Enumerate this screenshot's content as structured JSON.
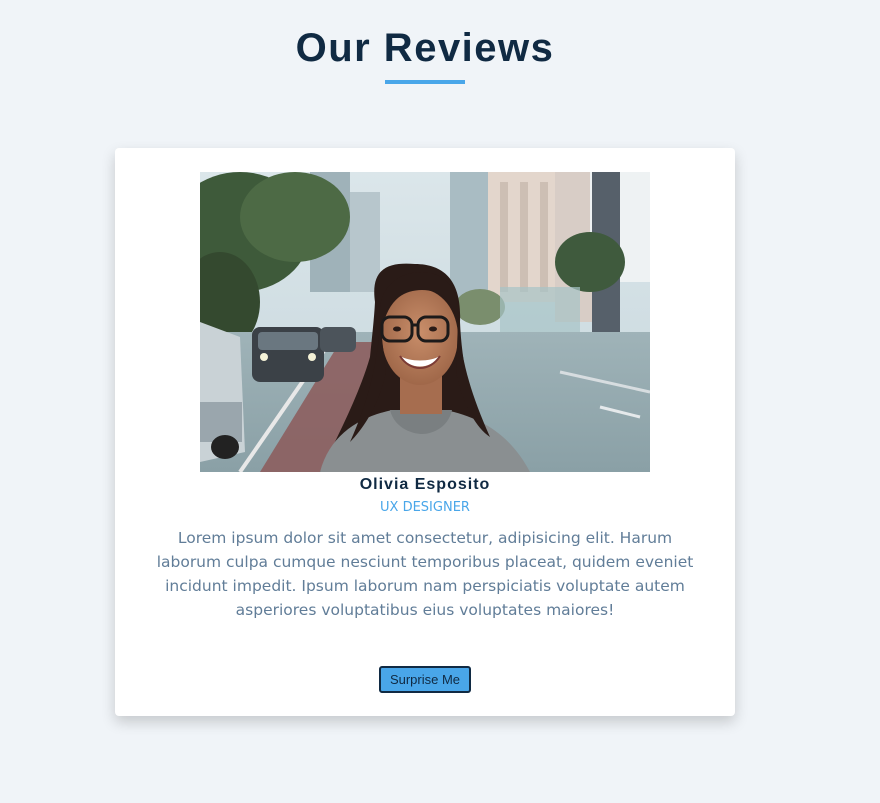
{
  "header": {
    "title": "Our Reviews"
  },
  "review": {
    "photo_alt": "Olivia Esposito",
    "author": "Olivia Esposito",
    "job": "UX DESIGNER",
    "info": "Lorem ipsum dolor sit amet consectetur, adipisicing elit. Harum laborum culpa cumque nesciunt temporibus placeat, quidem eveniet incidunt impedit. Ipsum laborum nam perspiciatis voluptate autem asperiores voluptatibus eius voluptates maiores!"
  },
  "controls": {
    "random_label": "Surprise Me"
  },
  "colors": {
    "background": "#f0f4f8",
    "primary": "#49a6e9",
    "heading": "#102a43",
    "body_text": "#617d98",
    "card": "#ffffff"
  }
}
